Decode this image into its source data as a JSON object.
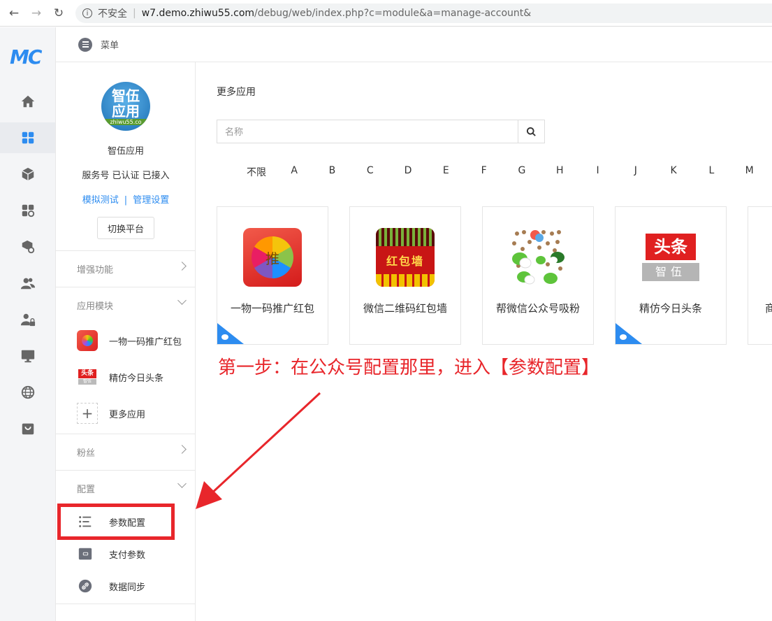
{
  "browser": {
    "insecure_label": "不安全",
    "url_host": "w7.demo.zhiwu55.com",
    "url_path": "/debug/web/index.php?c=module&a=manage-account&"
  },
  "rail": {
    "logo": "MC",
    "items": [
      "home-icon",
      "apps-icon",
      "cube-icon",
      "modules-icon",
      "box-settings-icon",
      "users-icon",
      "user-lock-icon",
      "monitor-icon",
      "globe-icon",
      "store-icon"
    ],
    "active_index": 1
  },
  "topbar": {
    "label": "菜单"
  },
  "account": {
    "logo_text_1": "智伍",
    "logo_text_2": "应用",
    "logo_url": "zhiwu55.co",
    "name": "智伍应用",
    "status": "服务号 已认证 已接入",
    "link_test": "模拟测试",
    "link_separator": "|",
    "link_manage": "管理设置",
    "switch_label": "切换平台"
  },
  "sidebar": {
    "sections": {
      "enhanced": "增强功能",
      "modules": "应用模块",
      "fans": "粉丝",
      "config": "配置"
    },
    "modules": [
      {
        "label": "一物一码推广红包",
        "icon": "red-packet-icon"
      },
      {
        "label": "精仿今日头条",
        "icon": "toutiao-icon",
        "badge_top": "头条",
        "badge_bottom": "智伍"
      },
      {
        "label": "更多应用",
        "icon": "plus-icon"
      }
    ],
    "config": [
      {
        "label": "参数配置",
        "icon": "list-settings-icon"
      },
      {
        "label": "支付参数",
        "icon": "wallet-icon"
      },
      {
        "label": "数据同步",
        "icon": "sync-link-icon"
      }
    ]
  },
  "main": {
    "title": "更多应用",
    "search_placeholder": "名称",
    "letters": [
      "不限",
      "A",
      "B",
      "C",
      "D",
      "E",
      "F",
      "G",
      "H",
      "I",
      "J",
      "K",
      "L",
      "M"
    ],
    "cards": [
      {
        "name": "一物一码推广红包",
        "img_text": "推",
        "corner": true
      },
      {
        "name": "微信二维码红包墙",
        "img_text": "红包墙",
        "corner": false
      },
      {
        "name": "帮微信公众号吸粉",
        "corner": false
      },
      {
        "name": "精仿今日头条",
        "img_text_top": "头条",
        "img_text_bottom": "智伍",
        "corner": true
      },
      {
        "name": "商",
        "corner": false
      }
    ]
  },
  "annotation": "第一步：在公众号配置那里，进入【参数配置】",
  "colors": {
    "accent": "#2d8cf0",
    "annotation": "#e8262b",
    "rail_bg": "#f4f5f7"
  }
}
